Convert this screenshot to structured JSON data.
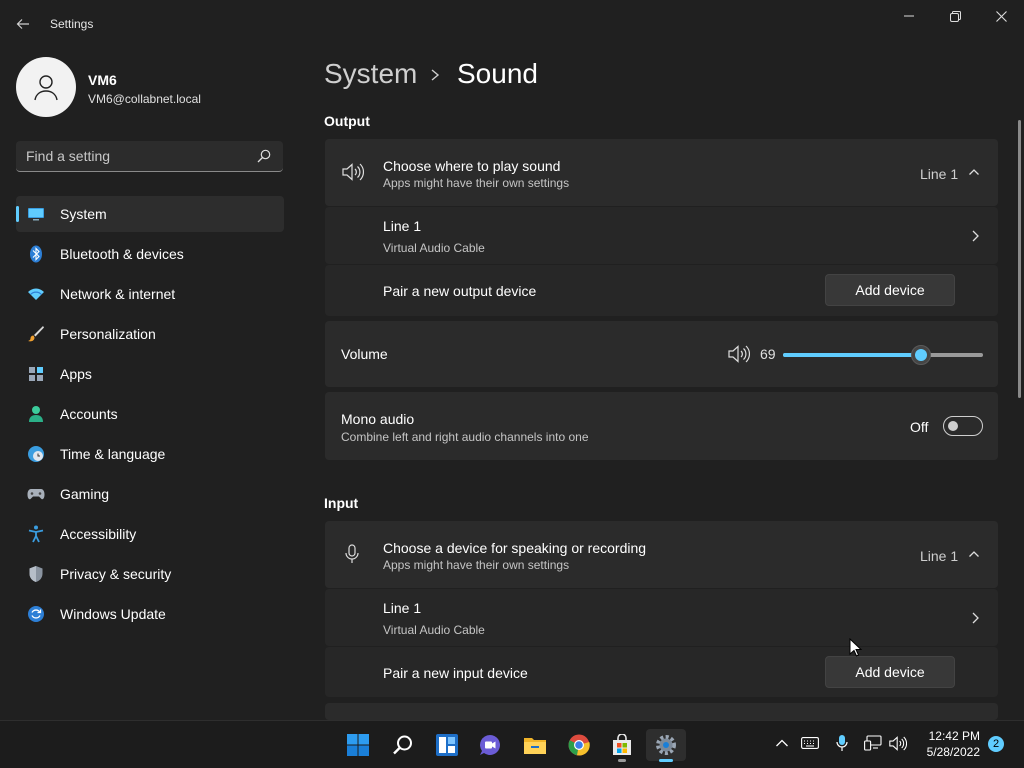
{
  "window": {
    "title": "Settings",
    "back_icon": "back-arrow-icon",
    "controls": [
      "minimize-icon",
      "maximize-icon",
      "close-icon"
    ]
  },
  "profile": {
    "name": "VM6",
    "email": "VM6@collabnet.local",
    "avatar_icon": "person-icon"
  },
  "search": {
    "placeholder": "Find a setting",
    "value": "",
    "icon": "search-icon"
  },
  "nav": {
    "items": [
      {
        "label": "System",
        "icon": "system-display-icon",
        "selected": true
      },
      {
        "label": "Bluetooth & devices",
        "icon": "bluetooth-icon"
      },
      {
        "label": "Network & internet",
        "icon": "wifi-icon"
      },
      {
        "label": "Personalization",
        "icon": "paintbrush-icon"
      },
      {
        "label": "Apps",
        "icon": "apps-icon"
      },
      {
        "label": "Accounts",
        "icon": "account-icon"
      },
      {
        "label": "Time & language",
        "icon": "globe-clock-icon"
      },
      {
        "label": "Gaming",
        "icon": "gamepad-icon"
      },
      {
        "label": "Accessibility",
        "icon": "accessibility-icon"
      },
      {
        "label": "Privacy & security",
        "icon": "shield-icon"
      },
      {
        "label": "Windows Update",
        "icon": "update-icon"
      }
    ]
  },
  "breadcrumb": {
    "parent": "System",
    "current": "Sound"
  },
  "output": {
    "section_title": "Output",
    "choose": {
      "title": "Choose where to play sound",
      "subtitle": "Apps might have their own settings",
      "value": "Line 1",
      "expanded": true
    },
    "device": {
      "name": "Line 1",
      "subtitle": "Virtual Audio Cable"
    },
    "pair": {
      "title": "Pair a new output device",
      "button": "Add device"
    },
    "volume": {
      "title": "Volume",
      "value": "69",
      "level": 0.69
    },
    "mono": {
      "title": "Mono audio",
      "subtitle": "Combine left and right audio channels into one",
      "state": "Off"
    }
  },
  "input": {
    "section_title": "Input",
    "choose": {
      "title": "Choose a device for speaking or recording",
      "subtitle": "Apps might have their own settings",
      "value": "Line 1",
      "expanded": true
    },
    "device": {
      "name": "Line 1",
      "subtitle": "Virtual Audio Cable"
    },
    "pair": {
      "title": "Pair a new input device",
      "button": "Add device"
    }
  },
  "taskbar": {
    "apps": [
      {
        "name": "start-icon"
      },
      {
        "name": "search-icon"
      },
      {
        "name": "widgets-icon"
      },
      {
        "name": "teams-chat-icon"
      },
      {
        "name": "file-explorer-icon"
      },
      {
        "name": "chrome-icon"
      },
      {
        "name": "store-icon"
      },
      {
        "name": "settings-gear-icon",
        "active": true
      }
    ],
    "tray": [
      "chevron-up-icon",
      "keyboard-icon",
      "microphone-icon",
      "network-icon",
      "speaker-icon"
    ],
    "clock": {
      "time": "12:42 PM",
      "date": "5/28/2022"
    },
    "notifications": "2"
  },
  "colors": {
    "accent": "#60cdff",
    "background": "#202020",
    "card": "#2b2b2b"
  }
}
